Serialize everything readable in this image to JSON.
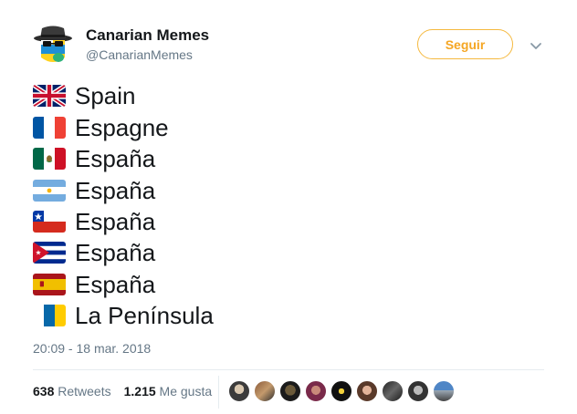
{
  "author": {
    "name": "Canarian Memes",
    "handle": "@CanarianMemes"
  },
  "follow_label": "Seguir",
  "lines": [
    {
      "flag": "uk-flag-icon",
      "text": "Spain"
    },
    {
      "flag": "france-flag-icon",
      "text": "Espagne"
    },
    {
      "flag": "mexico-flag-icon",
      "text": "España"
    },
    {
      "flag": "argentina-flag-icon",
      "text": "España"
    },
    {
      "flag": "chile-flag-icon",
      "text": "España"
    },
    {
      "flag": "cuba-flag-icon",
      "text": "España"
    },
    {
      "flag": "spain-flag-icon",
      "text": "España"
    },
    {
      "flag": "canary-islands-flag-icon",
      "text": "La Península"
    }
  ],
  "timestamp": "20:09 - 18 mar. 2018",
  "stats": {
    "retweets_count": "638",
    "retweets_label": "Retweets",
    "likes_count": "1.215",
    "likes_label": "Me gusta"
  },
  "colors": {
    "accent": "#f5a623",
    "muted": "#657786",
    "text": "#14171a"
  }
}
